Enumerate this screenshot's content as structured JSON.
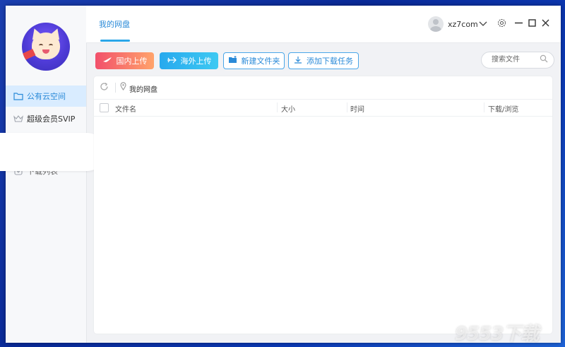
{
  "topbar": {
    "tab_title": "我的网盘",
    "username": "xz7com"
  },
  "sidebar": {
    "items": [
      {
        "label": "公有云空间",
        "icon": "folder-icon"
      },
      {
        "label": "超级会员SVIP",
        "icon": "crown-icon"
      },
      {
        "label": "下载列表",
        "icon": "download-list-icon"
      }
    ]
  },
  "toolbar": {
    "domestic_upload": "国内上传",
    "overseas_upload": "海外上传",
    "new_folder": "新建文件夹",
    "add_download_task": "添加下载任务"
  },
  "search": {
    "placeholder": "搜索文件"
  },
  "path": {
    "current": "我的网盘"
  },
  "table": {
    "columns": [
      "文件名",
      "大小",
      "时间",
      "下载/浏览"
    ]
  },
  "watermark": "9553下载",
  "colors": {
    "accent": "#2a8ad8",
    "domestic_gradient": [
      "#f2506b",
      "#ffa36b"
    ],
    "overseas_gradient": [
      "#27a9ee",
      "#3ec9f2"
    ],
    "desktop_bg": "#0d2a8f"
  }
}
